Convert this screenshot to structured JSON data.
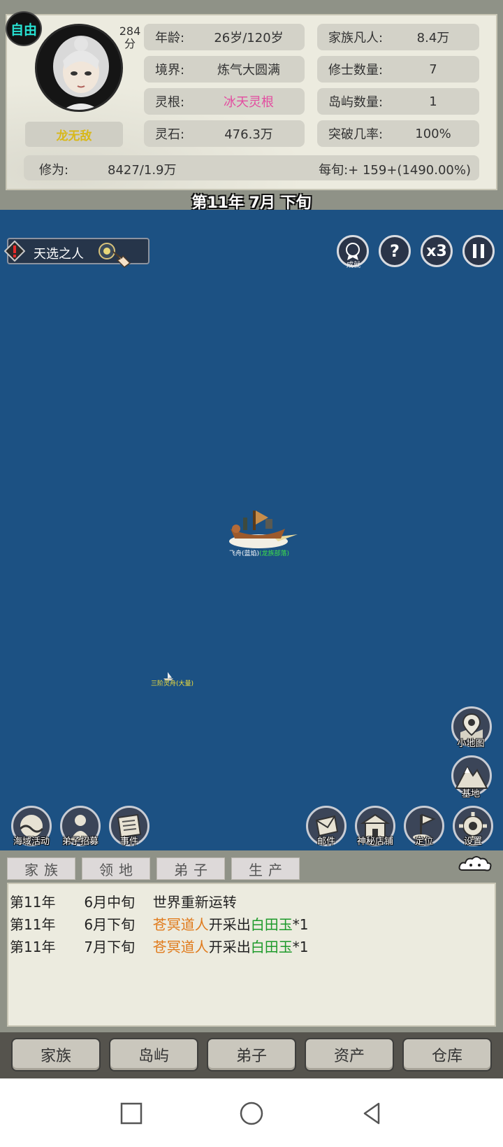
{
  "header": {
    "mode_badge": "自由",
    "score": "284",
    "score_unit": "分",
    "player_name": "龙无敌",
    "stats_left": [
      {
        "key": "年龄:",
        "value": "26岁/120岁"
      },
      {
        "key": "境界:",
        "value": "炼气大圆满"
      },
      {
        "key": "灵根:",
        "value": "冰天灵根"
      },
      {
        "key": "灵石:",
        "value": "476.3万"
      }
    ],
    "stats_right": [
      {
        "key": "家族凡人:",
        "value": "8.4万"
      },
      {
        "key": "修士数量:",
        "value": "7"
      },
      {
        "key": "岛屿数量:",
        "value": "1"
      },
      {
        "key": "突破几率:",
        "value": "100%"
      }
    ],
    "cultivation_label": "修为:",
    "cultivation_value": "8427/1.9万",
    "per_turn": "每旬:+ 159+(1490.00%)",
    "date": "第11年 7月 下旬",
    "highlight_color": "#e34da0"
  },
  "sea": {
    "event_button": "天选之人",
    "achievement_label": "成就",
    "help_label": "?",
    "speed_label": "x3",
    "pause_icon": "pause-icon",
    "ship_name": "飞舟(蓝焰)",
    "ship_owner": "(龙族部落)",
    "small_ship_label": "三阶灵舟(大量)",
    "side_buttons": [
      {
        "label": "小地图",
        "icon": "map-pin-icon"
      },
      {
        "label": "基地",
        "icon": "mountain-icon"
      }
    ],
    "left_buttons": [
      {
        "label": "海域活动",
        "icon": "wave-icon"
      },
      {
        "label": "弟子招募",
        "icon": "disciple-icon"
      },
      {
        "label": "事件",
        "icon": "scroll-icon"
      }
    ],
    "right_buttons": [
      {
        "label": "邮件",
        "icon": "mail-icon"
      },
      {
        "label": "神秘店铺",
        "icon": "shop-icon"
      },
      {
        "label": "定位",
        "icon": "flag-icon"
      },
      {
        "label": "设置",
        "icon": "gear-icon"
      }
    ]
  },
  "log": {
    "tabs": [
      "家族",
      "领地",
      "弟子",
      "生产"
    ],
    "rows": [
      {
        "year": "第11年",
        "time": "6月中旬",
        "parts": [
          {
            "t": "世界重新运转",
            "c": ""
          }
        ]
      },
      {
        "year": "第11年",
        "time": "6月下旬",
        "parts": [
          {
            "t": "苍冥道人",
            "c": "orange"
          },
          {
            "t": "开采出",
            "c": ""
          },
          {
            "t": "白田玉",
            "c": "green"
          },
          {
            "t": "*1",
            "c": ""
          }
        ]
      },
      {
        "year": "第11年",
        "time": "7月下旬",
        "parts": [
          {
            "t": "苍冥道人",
            "c": "orange"
          },
          {
            "t": "开采出",
            "c": ""
          },
          {
            "t": "白田玉",
            "c": "green"
          },
          {
            "t": "*1",
            "c": ""
          }
        ]
      }
    ]
  },
  "main_nav": [
    "家族",
    "岛屿",
    "弟子",
    "资产",
    "仓库"
  ]
}
